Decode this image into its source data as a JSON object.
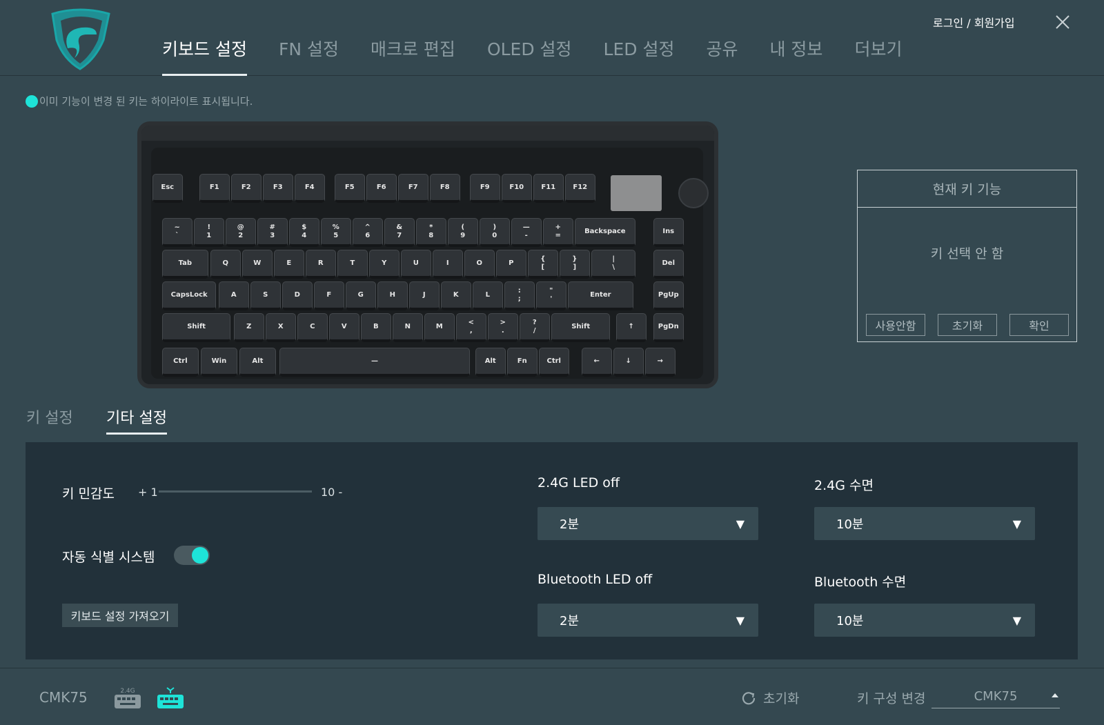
{
  "header": {
    "logo_icon": "snake-shield-logo",
    "tabs": [
      {
        "label": "키보드 설정",
        "active": true
      },
      {
        "label": "FN 설정",
        "active": false
      },
      {
        "label": "매크로 편집",
        "active": false
      },
      {
        "label": "OLED 설정",
        "active": false
      },
      {
        "label": "LED 설정",
        "active": false
      },
      {
        "label": "공유",
        "active": false
      },
      {
        "label": "내 정보",
        "active": false
      },
      {
        "label": "더보기",
        "active": false
      }
    ],
    "login": "로그인 / 회원가입",
    "close_icon": "close-icon"
  },
  "hint": "이미 기능이 변경 된 키는 하이라이트 표시됩니다.",
  "accent_color": "#1ee3d8",
  "keyboard": {
    "keys": [
      "Esc",
      "F1",
      "F2",
      "F3",
      "F4",
      "F5",
      "F6",
      "F7",
      "F8",
      "F9",
      "F10",
      "F11",
      "F12",
      "~\n`",
      "!\n1",
      "@\n2",
      "#\n3",
      "$\n4",
      "%\n5",
      "^\n6",
      "&\n7",
      "*\n8",
      "(\n9",
      ")\n0",
      "—\n-",
      "+\n=",
      "Backspace",
      "Ins",
      "Tab",
      "Q",
      "W",
      "E",
      "R",
      "T",
      "Y",
      "U",
      "I",
      "O",
      "P",
      "{\n[",
      "}\n]",
      "|\n\\",
      "Del",
      "CapsLock",
      "A",
      "S",
      "D",
      "F",
      "G",
      "H",
      "J",
      "K",
      "L",
      ":\n;",
      "\"\n'",
      "Enter",
      "PgUp",
      "Shift",
      "Z",
      "X",
      "C",
      "V",
      "B",
      "N",
      "M",
      "<\n,",
      ">\n.",
      "?\n/",
      "Shift",
      "↑",
      "PgDn",
      "Ctrl",
      "Win",
      "Alt",
      "—",
      "Alt",
      "Fn",
      "Ctrl",
      "←",
      "↓",
      "→"
    ]
  },
  "key_panel": {
    "title": "현재 키 기능",
    "status": "키 선택 안 함",
    "buttons": [
      "사용안함",
      "초기화",
      "확인"
    ]
  },
  "sub_tabs": [
    {
      "label": "키 설정",
      "active": false
    },
    {
      "label": "기타 설정",
      "active": true
    }
  ],
  "settings": {
    "sensitivity": {
      "label": "키 민감도",
      "min": "+ 1",
      "max": "10 -"
    },
    "auto_detect": {
      "label": "자동 식별 시스템",
      "enabled": true
    },
    "import_button": "키보드 설정 가져오기",
    "led_24g": {
      "label": "2.4G LED off",
      "value": "2분"
    },
    "sleep_24g": {
      "label": "2.4G 수면",
      "value": "10분"
    },
    "led_bt": {
      "label": "Bluetooth LED off",
      "value": "2분"
    },
    "sleep_bt": {
      "label": "Bluetooth 수면",
      "value": "10분"
    },
    "dropdown_arrow": "▼"
  },
  "bottom": {
    "model": "CMK75",
    "icon_24g_label": "2.4G",
    "reset": "초기화",
    "layout_label": "키 구성 변경",
    "layout_value": "CMK75"
  }
}
